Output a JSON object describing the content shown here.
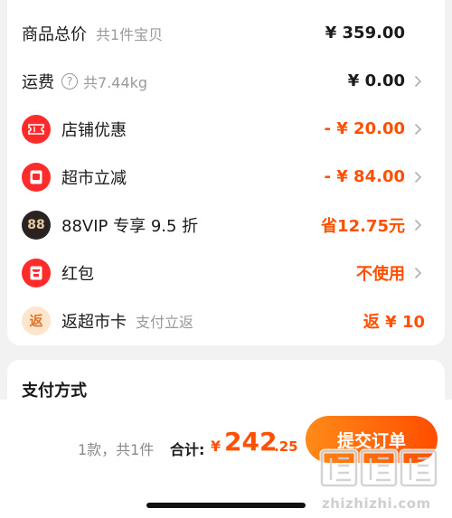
{
  "summary": {
    "total_label": "商品总价",
    "total_sub": "共1件宝贝",
    "total_value": "¥ 359.00",
    "shipping_label": "运费",
    "shipping_sub": "共7.44kg",
    "shipping_value": "¥ 0.00",
    "shop_discount_label": "店铺优惠",
    "shop_discount_value": "- ¥ 20.00",
    "market_discount_label": "超市立减",
    "market_discount_value": "- ¥ 84.00",
    "vip_badge": "88",
    "vip_label": "88VIP 专享 9.5 折",
    "vip_value": "省12.75元",
    "redpacket_label": "红包",
    "redpacket_value": "不使用",
    "cashback_badge": "返",
    "cashback_label": "返超市卡",
    "cashback_sub": "支付立返",
    "cashback_value": "返 ¥ 10"
  },
  "payment": {
    "title": "支付方式"
  },
  "footer": {
    "count_text": "1款，共1件",
    "total_label": "合计:",
    "currency": "¥",
    "total_int": "242",
    "total_dec": ".25",
    "submit_label": "提交订单"
  },
  "watermark": {
    "glyphs": "值值值",
    "text": "zhizhizhi.com"
  },
  "colors": {
    "accent": "#ff5000",
    "button_start": "#ff8a18",
    "button_end": "#ff4d00",
    "badge_red": "#ff2b2b"
  }
}
